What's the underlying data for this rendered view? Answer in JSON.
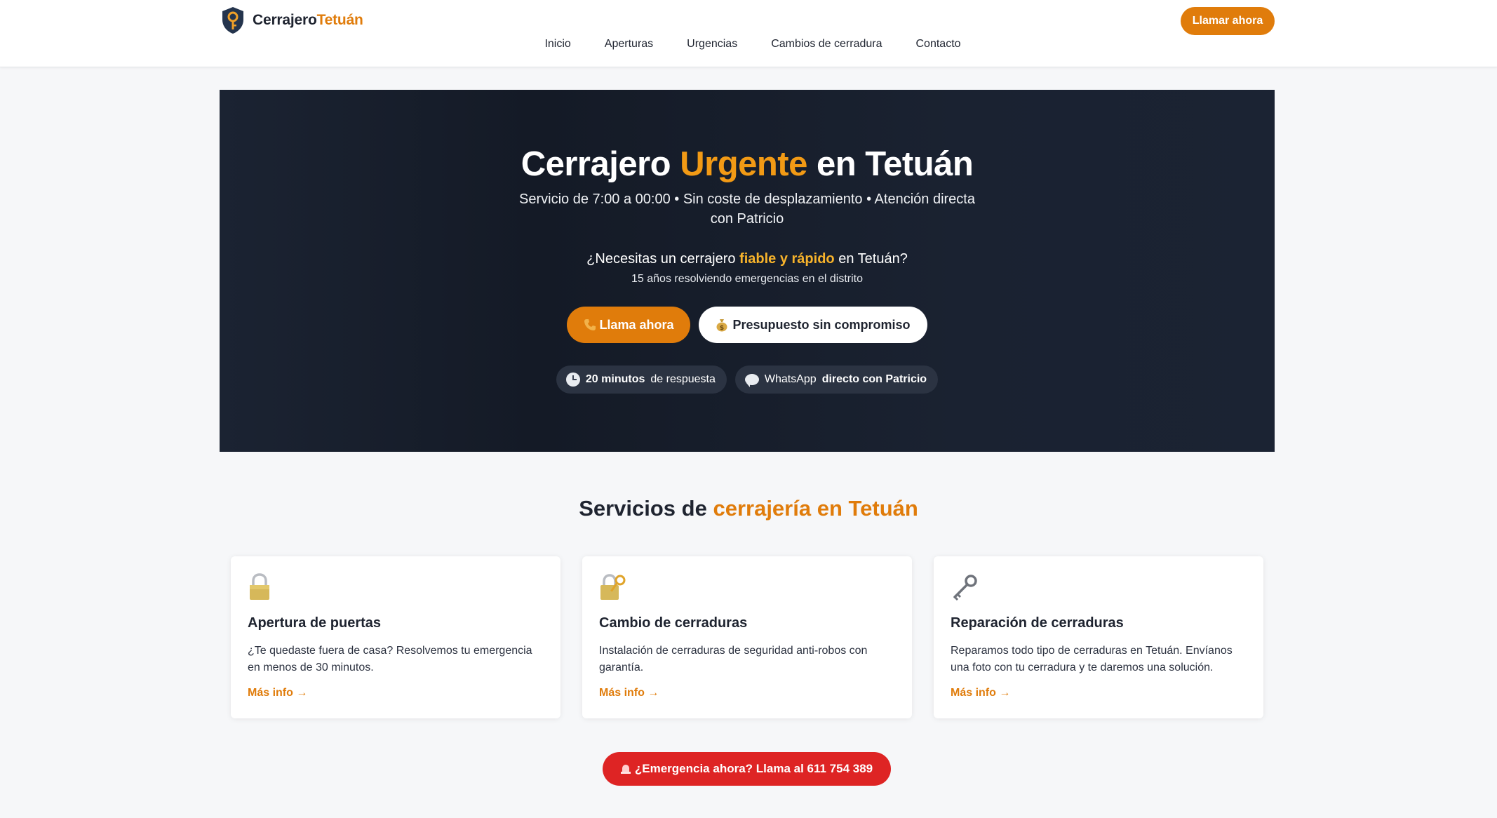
{
  "header": {
    "logo_name": "Cerrajero",
    "logo_accent": "Tetuán",
    "nav": [
      "Inicio",
      "Aperturas",
      "Urgencias",
      "Cambios de cerradura",
      "Contacto"
    ],
    "cta_label": "Llamar ahora"
  },
  "hero": {
    "title_pre": "Cerrajero ",
    "title_accent": "Urgente",
    "title_post": " en Tetuán",
    "subtitle": "Servicio de 7:00 a 00:00 • Sin coste de desplazamiento • Atención directa con Patricio",
    "question_pre": "¿Necesitas un cerrajero ",
    "question_highlight": "fiable y rápido",
    "question_post": " en Tetuán?",
    "note": "15 años resolviendo emergencias en el distrito",
    "primary_button": "Llama ahora",
    "secondary_button": "Presupuesto sin compromiso",
    "badge_response_strong": "20 minutos",
    "badge_response_text": "de respuesta",
    "badge_whatsapp_text": "WhatsApp",
    "badge_whatsapp_strong": "directo con Patricio"
  },
  "services": {
    "title_pre": "Servicios de ",
    "title_accent": "cerrajería en Tetuán",
    "cards": [
      {
        "icon": "padlock-icon",
        "title": "Apertura de puertas",
        "text": "¿Te quedaste fuera de casa? Resolvemos tu emergencia en menos de 30 minutos.",
        "link": "Más info →"
      },
      {
        "icon": "lock-with-key-icon",
        "title": "Cambio de cerraduras",
        "text": "Instalación de cerraduras de seguridad anti-robos con garantía.",
        "link": "Más info →"
      },
      {
        "icon": "old-key-icon",
        "title": "Reparación de cerraduras",
        "text": "Reparamos todo tipo de cerraduras en Tetuán. Envíanos una foto con tu cerradura y te daremos una solución.",
        "link": "Más info →"
      }
    ]
  },
  "emergency_button": "¿Emergencia ahora? Llama al 611 754 389",
  "colors": {
    "accent": "#e07c0b",
    "hero_bg": "#1b2332",
    "emergency": "#de2424",
    "highlight": "#f7b32b"
  }
}
